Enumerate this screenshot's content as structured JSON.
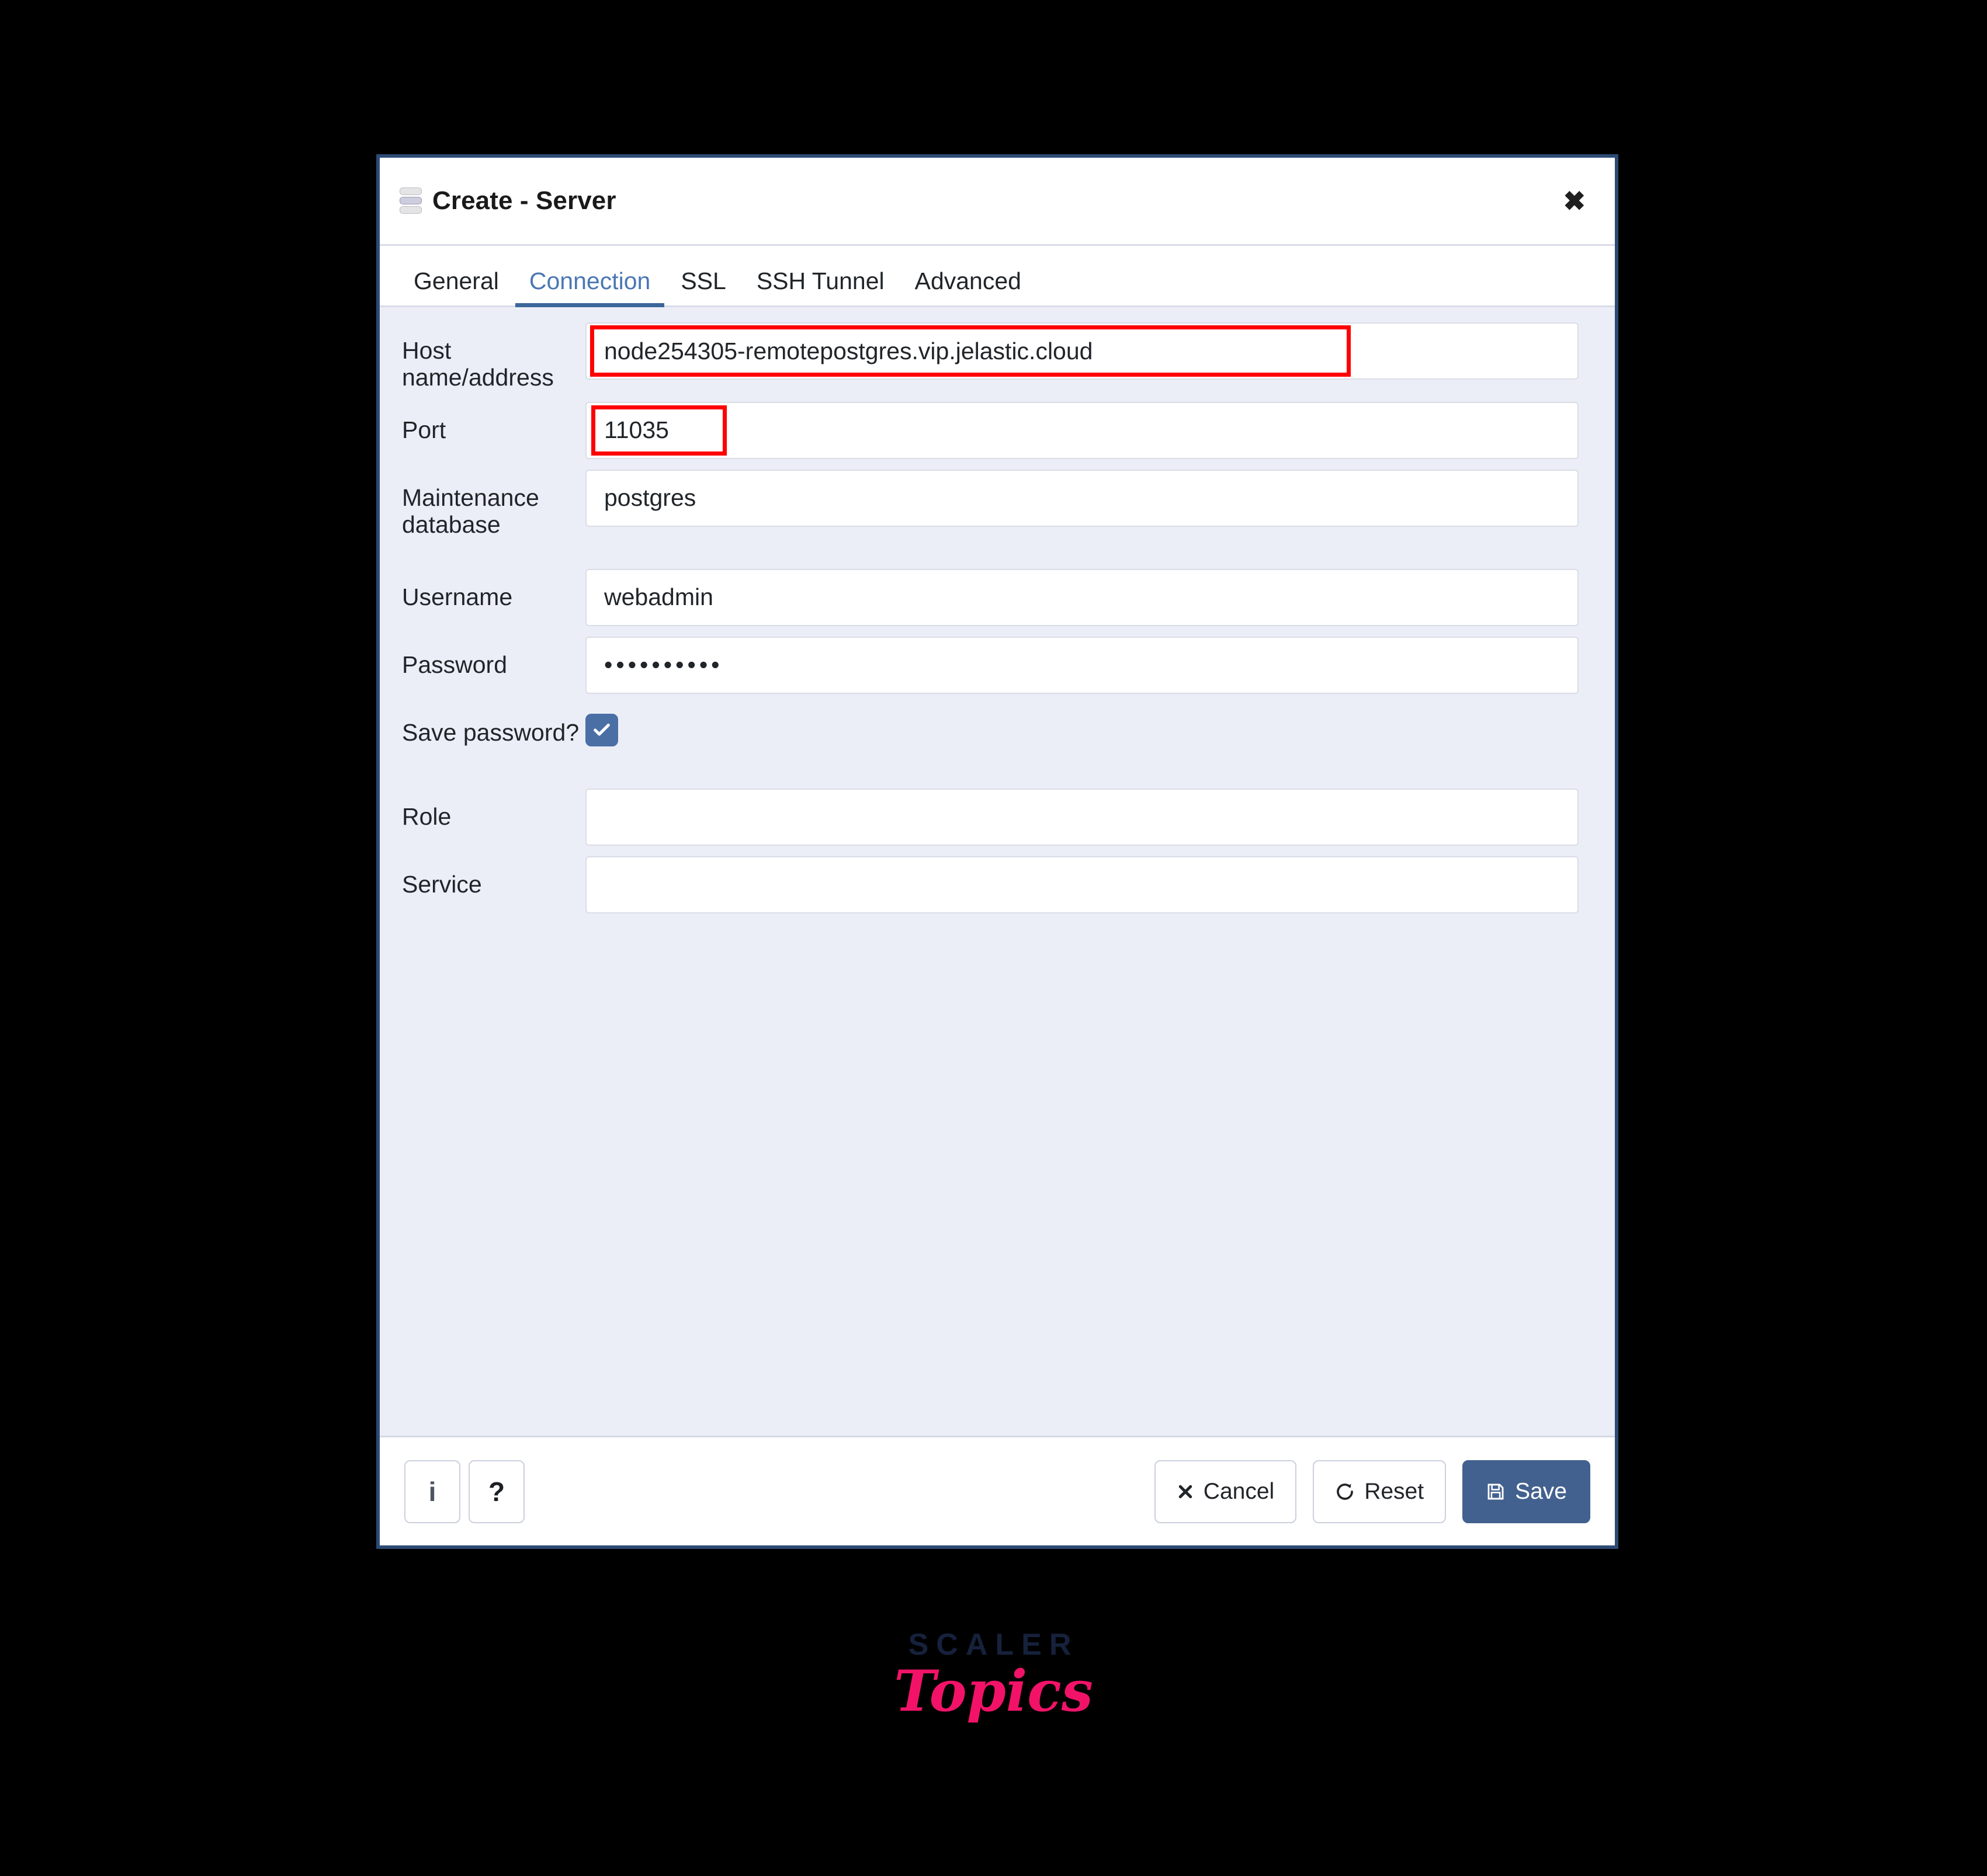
{
  "dialog": {
    "title": "Create - Server",
    "title_icon": "database-icon",
    "close_icon": "close-icon",
    "close_label": "✖"
  },
  "tabs": [
    {
      "label": "General",
      "active": false
    },
    {
      "label": "Connection",
      "active": true
    },
    {
      "label": "SSL",
      "active": false
    },
    {
      "label": "SSH Tunnel",
      "active": false
    },
    {
      "label": "Advanced",
      "active": false
    }
  ],
  "form": {
    "host": {
      "label": "Host name/address",
      "value": "node254305-remotepostgres.vip.jelastic.cloud",
      "placeholder": "",
      "highlighted": true
    },
    "port": {
      "label": "Port",
      "value": "11035",
      "placeholder": "",
      "highlighted": true
    },
    "maintenance_db": {
      "label": "Maintenance database",
      "value": "postgres",
      "placeholder": ""
    },
    "username": {
      "label": "Username",
      "value": "webadmin",
      "placeholder": ""
    },
    "password": {
      "label": "Password",
      "value": "••••••••••",
      "placeholder": ""
    },
    "save_password": {
      "label": "Save password?",
      "checked": true,
      "icon": "checkmark-icon"
    },
    "role": {
      "label": "Role",
      "value": "",
      "placeholder": ""
    },
    "service": {
      "label": "Service",
      "value": "",
      "placeholder": ""
    }
  },
  "footer": {
    "info_label": "i",
    "info_icon": "info-icon",
    "help_label": "?",
    "help_icon": "help-icon",
    "cancel_label": "Cancel",
    "cancel_icon": "x-icon",
    "reset_label": "Reset",
    "reset_icon": "refresh-icon",
    "save_label": "Save",
    "save_icon": "floppy-disk-icon"
  },
  "watermark": {
    "line1": "SCALER",
    "line2": "Topics"
  },
  "colors": {
    "accent_blue": "#3c6699",
    "tab_active_text": "#4a77b4",
    "primary_button": "#43618f",
    "annotation_red": "#fe0000",
    "form_background": "#eceef7",
    "dialog_border": "#2c4a73",
    "logo_dark": "#16213c",
    "logo_pink": "#f21368"
  }
}
